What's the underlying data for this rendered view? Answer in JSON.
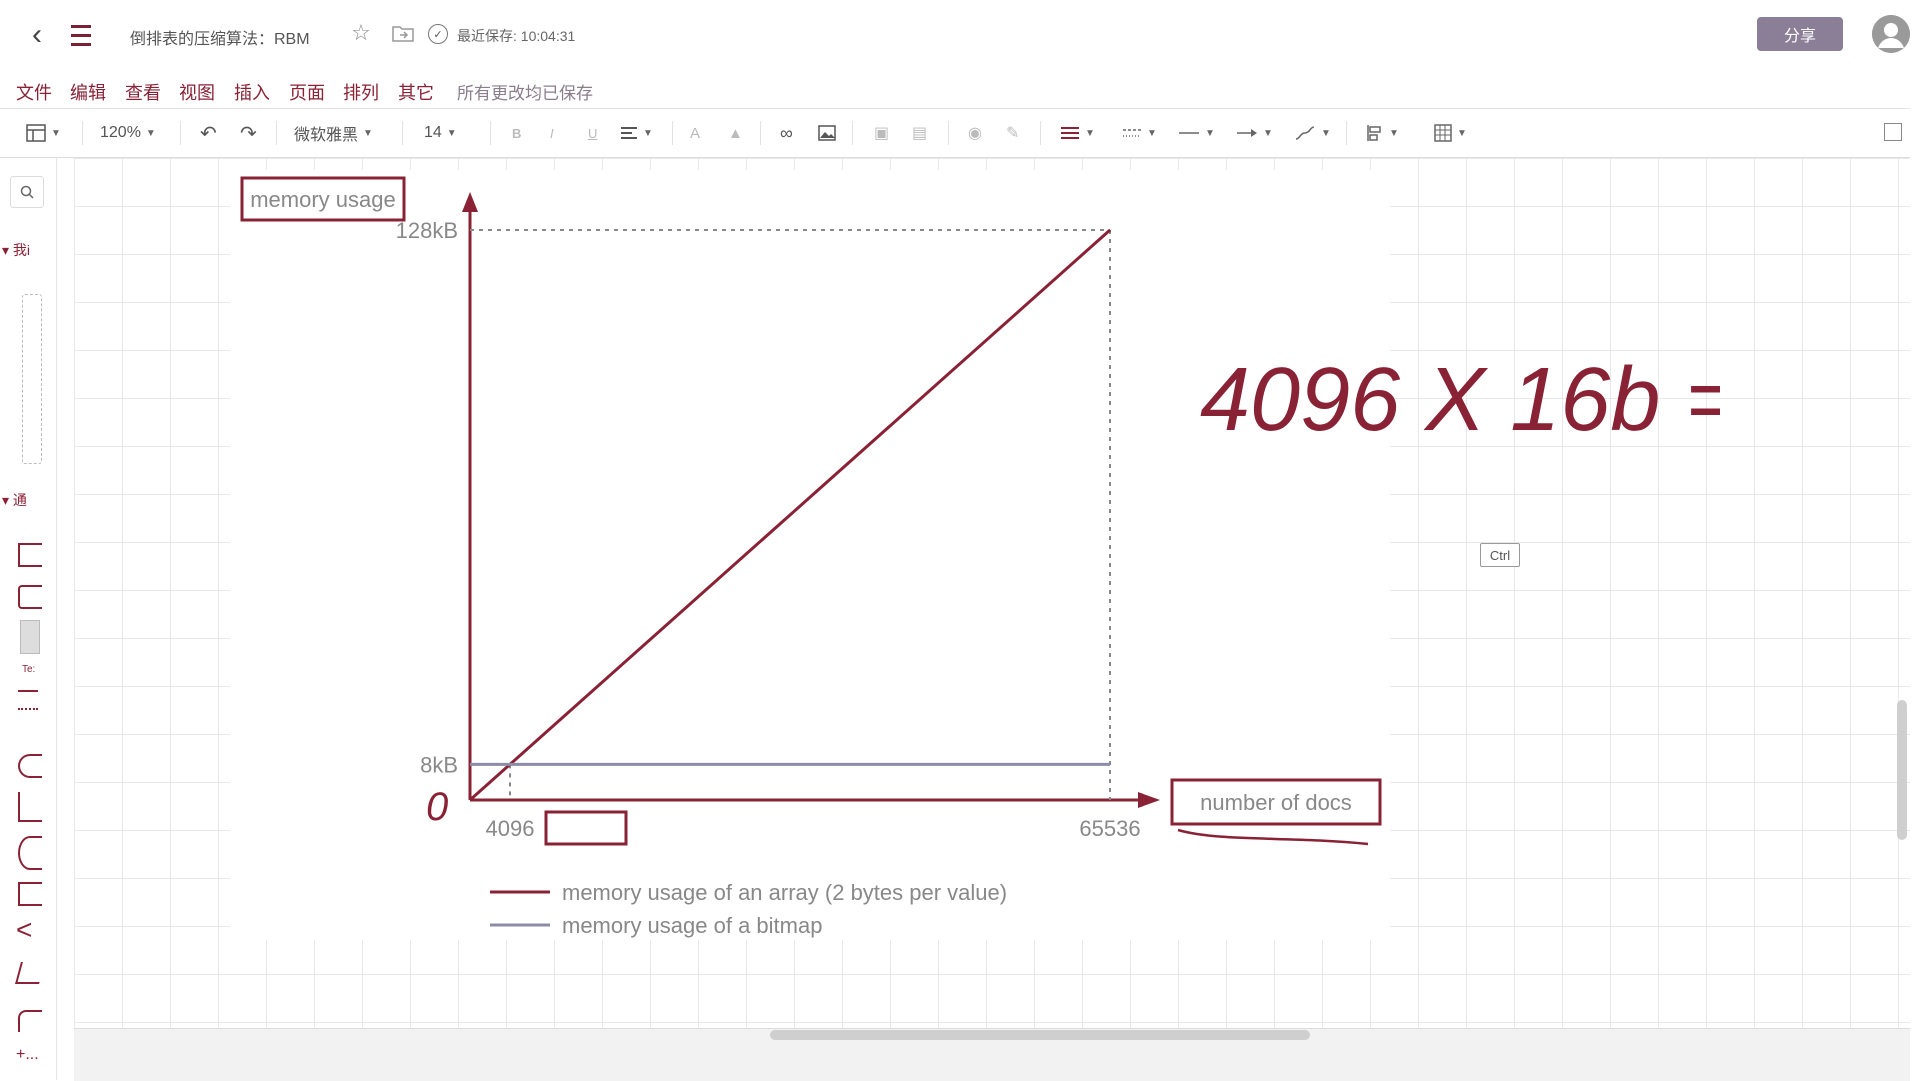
{
  "topbar": {
    "title": "倒排表的压缩算法：RBM",
    "save_status": "最近保存: 10:04:31",
    "share_label": "分享"
  },
  "menubar": {
    "items": [
      "文件",
      "编辑",
      "查看",
      "视图",
      "插入",
      "页面",
      "排列",
      "其它"
    ],
    "status": "所有更改均已保存"
  },
  "toolbar": {
    "zoom": "120%",
    "font_family_value": "微软雅黑",
    "font_size_value": "14"
  },
  "leftpanel": {
    "section_1": "我i",
    "section_2": "通",
    "text_shape_label": "Te:",
    "more_label": "+..."
  },
  "figure": {
    "y_axis_label": "memory usage",
    "x_axis_label": "number of docs",
    "y_tick_high": "128kB",
    "y_tick_mid": "8kB",
    "x_tick_mid": "4096",
    "x_tick_high": "65536",
    "legend_array": "memory usage of an array (2 bytes per value)",
    "legend_bitmap": "memory usage of a bitmap",
    "handwritten_origin": "0",
    "handwritten_note": "4096 X 16b ="
  },
  "ctrl_badge": "Ctrl",
  "colors": {
    "accent": "#8a2236",
    "array_line": "#8a2236",
    "bitmap_line": "#8c8ca8",
    "share_button": "#8b7f98"
  },
  "chart_data": {
    "type": "line",
    "title": "",
    "xlabel": "number of docs",
    "ylabel": "memory usage",
    "x_ticks": [
      "4096",
      "65536"
    ],
    "y_ticks": [
      "8kB",
      "128kB"
    ],
    "xlim": [
      0,
      65536
    ],
    "ylim": [
      0,
      128
    ],
    "series": [
      {
        "name": "memory usage of an array (2 bytes per value)",
        "x": [
          0,
          65536
        ],
        "y": [
          0,
          128
        ]
      },
      {
        "name": "memory usage of a bitmap",
        "x": [
          0,
          65536
        ],
        "y": [
          8,
          8
        ]
      }
    ],
    "annotations": [
      "0",
      "4096 X 16b ="
    ],
    "legend": "bottom-left",
    "grid": false
  }
}
